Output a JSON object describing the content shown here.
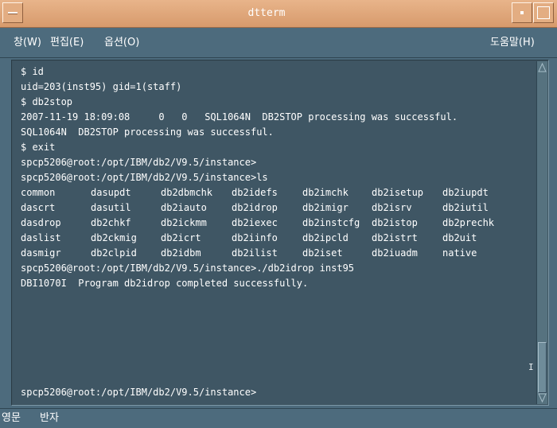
{
  "window": {
    "title": "dtterm"
  },
  "menu": {
    "items": [
      {
        "label": "창(W)"
      },
      {
        "label": "편집(E)"
      },
      {
        "label": "옵션(O)"
      }
    ],
    "help": "도움말(H)"
  },
  "terminal": {
    "lines": [
      "$ id",
      "uid=203(inst95) gid=1(staff)",
      "$ db2stop",
      "2007-11-19 18:09:08     0   0   SQL1064N  DB2STOP processing was successful.",
      "SQL1064N  DB2STOP processing was successful.",
      "$ exit",
      "spcp5206@root:/opt/IBM/db2/V9.5/instance>",
      "spcp5206@root:/opt/IBM/db2/V9.5/instance>ls"
    ],
    "ls_rows": [
      [
        "common",
        "dasupdt",
        "db2dbmchk",
        "db2idefs",
        "db2imchk",
        "db2isetup",
        "db2iupdt"
      ],
      [
        "dascrt",
        "dasutil",
        "db2iauto",
        "db2idrop",
        "db2imigr",
        "db2isrv",
        "db2iutil"
      ],
      [
        "dasdrop",
        "db2chkf",
        "db2ickmm",
        "db2iexec",
        "db2instcfg",
        "db2istop",
        "db2prechk"
      ],
      [
        "daslist",
        "db2ckmig",
        "db2icrt",
        "db2iinfo",
        "db2ipcld",
        "db2istrt",
        "db2uit"
      ],
      [
        "dasmigr",
        "db2clpid",
        "db2idbm",
        "db2ilist",
        "db2iset",
        "db2iuadm",
        "native"
      ]
    ],
    "after_lines": [
      "spcp5206@root:/opt/IBM/db2/V9.5/instance>./db2idrop inst95",
      "DBI1070I  Program db2idrop completed successfully."
    ],
    "prompt": "spcp5206@root:/opt/IBM/db2/V9.5/instance>"
  },
  "status": {
    "input_mode": "영문",
    "width_mode": "반자"
  },
  "colors": {
    "title_bar": "#d79a6c",
    "window_bg": "#4d6b7d",
    "terminal_bg": "#3f5664",
    "text": "#ffffff"
  }
}
